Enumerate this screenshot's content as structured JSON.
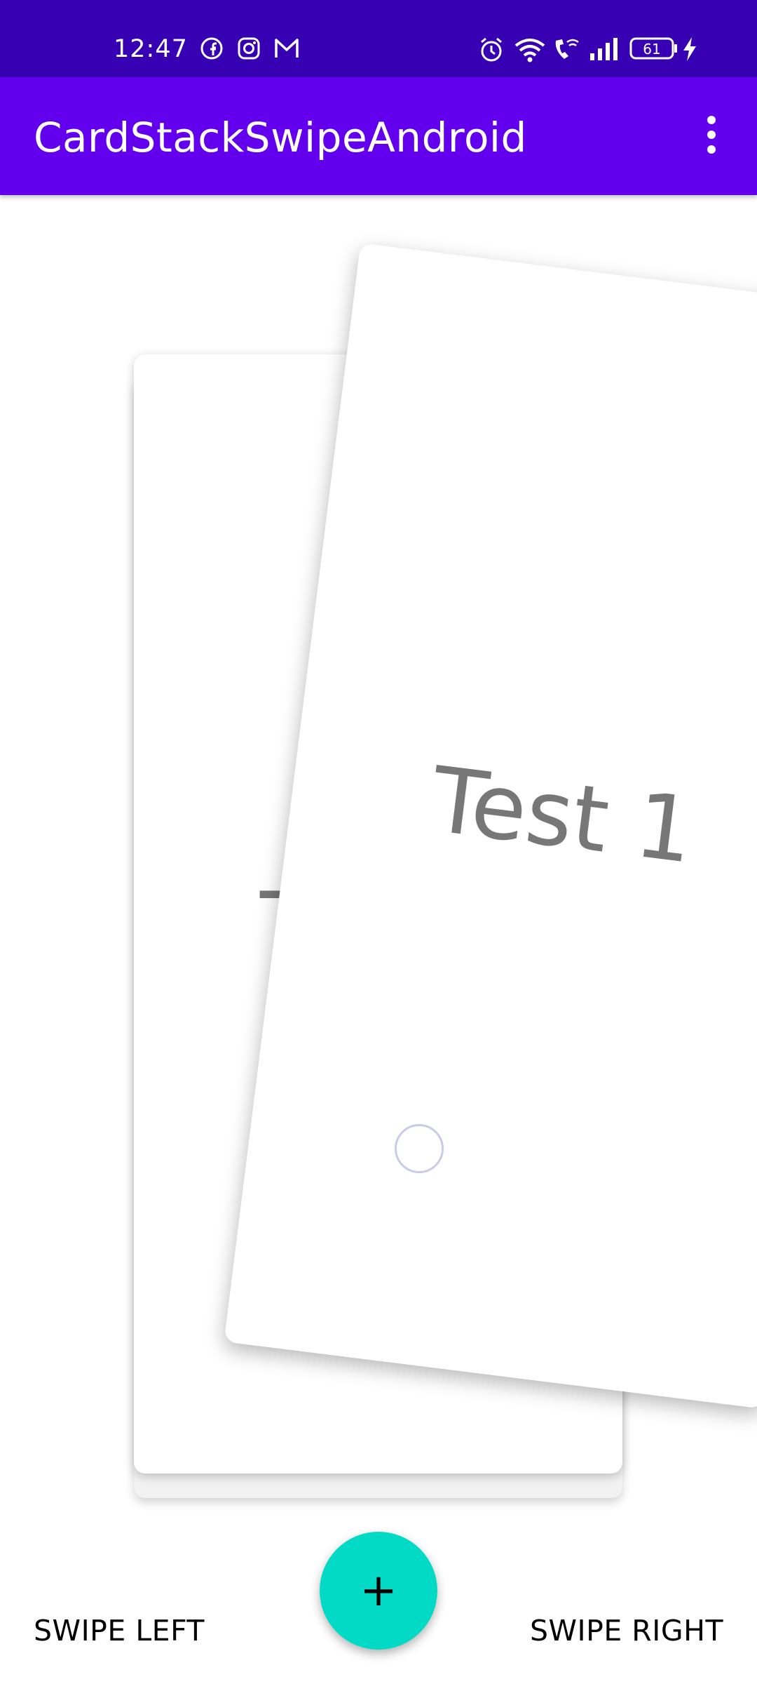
{
  "status_bar": {
    "time": "12:47",
    "left_icons": [
      "facebook-icon",
      "instagram-icon",
      "gmail-icon"
    ],
    "right_icons": [
      "alarm-icon",
      "wifi-icon",
      "wifi-calling-icon",
      "signal-icon",
      "battery-icon",
      "charging-icon"
    ],
    "battery_level": "61"
  },
  "app_bar": {
    "title": "CardStackSwipeAndroid",
    "menu_icon": "more-vert-icon"
  },
  "cards": {
    "front_text": "Test 1",
    "back_text": "T"
  },
  "fab": {
    "icon": "+",
    "icon_name": "add-icon"
  },
  "buttons": {
    "swipe_left": "SWIPE LEFT",
    "swipe_right": "SWIPE RIGHT"
  },
  "colors": {
    "status_bar": "#3700b3",
    "app_bar": "#6200ee",
    "fab": "#03dac5"
  }
}
